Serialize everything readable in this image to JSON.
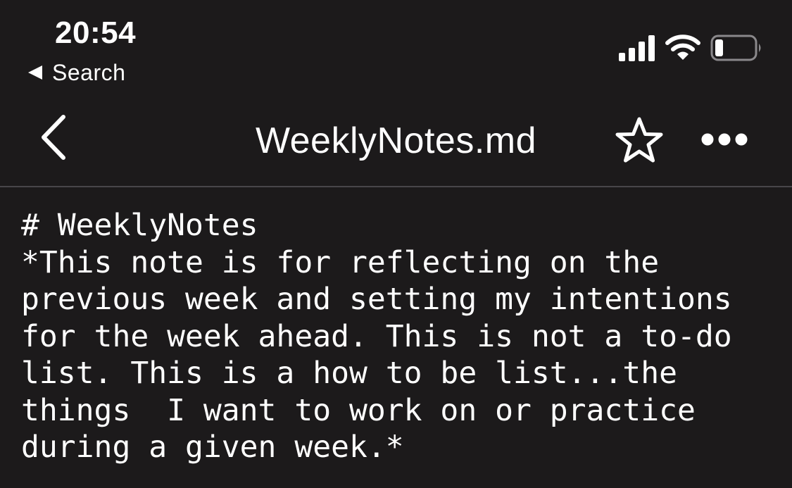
{
  "status_bar": {
    "time": "20:54",
    "back_app_label": "Search",
    "icons": [
      "cellular-signal-icon",
      "wifi-icon",
      "battery-icon"
    ]
  },
  "nav": {
    "title": "WeeklyNotes.md",
    "icons": [
      "chevron-left-icon",
      "star-outline-icon",
      "more-horizontal-icon"
    ]
  },
  "editor": {
    "lines": [
      "# WeeklyNotes",
      "*This note is for reflecting on the",
      "previous week and setting my intentions",
      "for the week ahead. This is not a to-do",
      "list. This is a how to be list...the",
      "things  I want to work on or practice",
      "during a given week.*"
    ]
  },
  "colors": {
    "background": "#1c1a1b",
    "text": "#ffffff",
    "divider": "#48464a"
  }
}
